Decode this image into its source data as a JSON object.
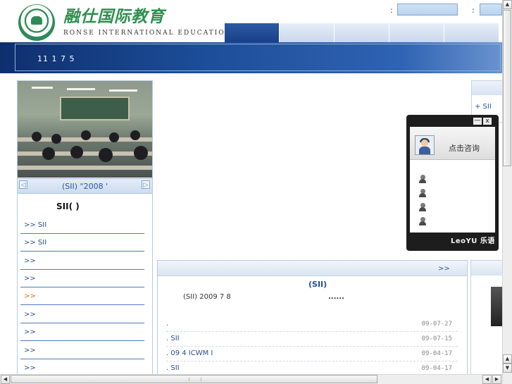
{
  "header": {
    "brand_cn": "融仕国际教育",
    "brand_en": "RONSE INTERNATIONAL EDUCATION",
    "login_colon_1": ":",
    "login_colon_2": ":"
  },
  "banner": {
    "text": "11 1 7 5"
  },
  "slideshow": {
    "prev_symbol": "◁",
    "next_symbol": "▷",
    "caption": "(SII) \"2008      '"
  },
  "left_menu": {
    "heading": "SII(              )",
    "items": [
      {
        "label": ">> SII"
      },
      {
        "label": ">> SII"
      },
      {
        "label": ">>"
      },
      {
        "label": ">>"
      },
      {
        "label": ">>"
      },
      {
        "label": ">>"
      },
      {
        "label": ">>"
      },
      {
        "label": ">>"
      },
      {
        "label": ">>"
      }
    ]
  },
  "right_panel": {
    "item": "+ SII"
  },
  "news": {
    "more": ">>",
    "title": "(SII)",
    "summary": "(SII)            2009 7 8",
    "summary_ellipsis": "......",
    "rows": [
      {
        "title": ".",
        "date": "09-07-27"
      },
      {
        "title": ". SII",
        "date": "09-07-15"
      },
      {
        "title": ".    09 4   ICWM      I",
        "date": "09-04-17"
      },
      {
        "title": ". SII",
        "date": "09-04-17"
      }
    ]
  },
  "chat": {
    "minimize_symbol": "—",
    "close_symbol": "x",
    "consult_label": "点击咨询",
    "brand": "LeoYU",
    "brand_cn": "乐语"
  },
  "scrollbar": {
    "up_symbol": "▲",
    "down_symbol": "▼",
    "left_symbol": "◀",
    "right_symbol": "▶"
  },
  "colors": {
    "brand_green": "#2f8f4f",
    "nav_blue": "#1a4087",
    "link_blue": "#2a4f8f",
    "hot_orange": "#e06b10"
  }
}
